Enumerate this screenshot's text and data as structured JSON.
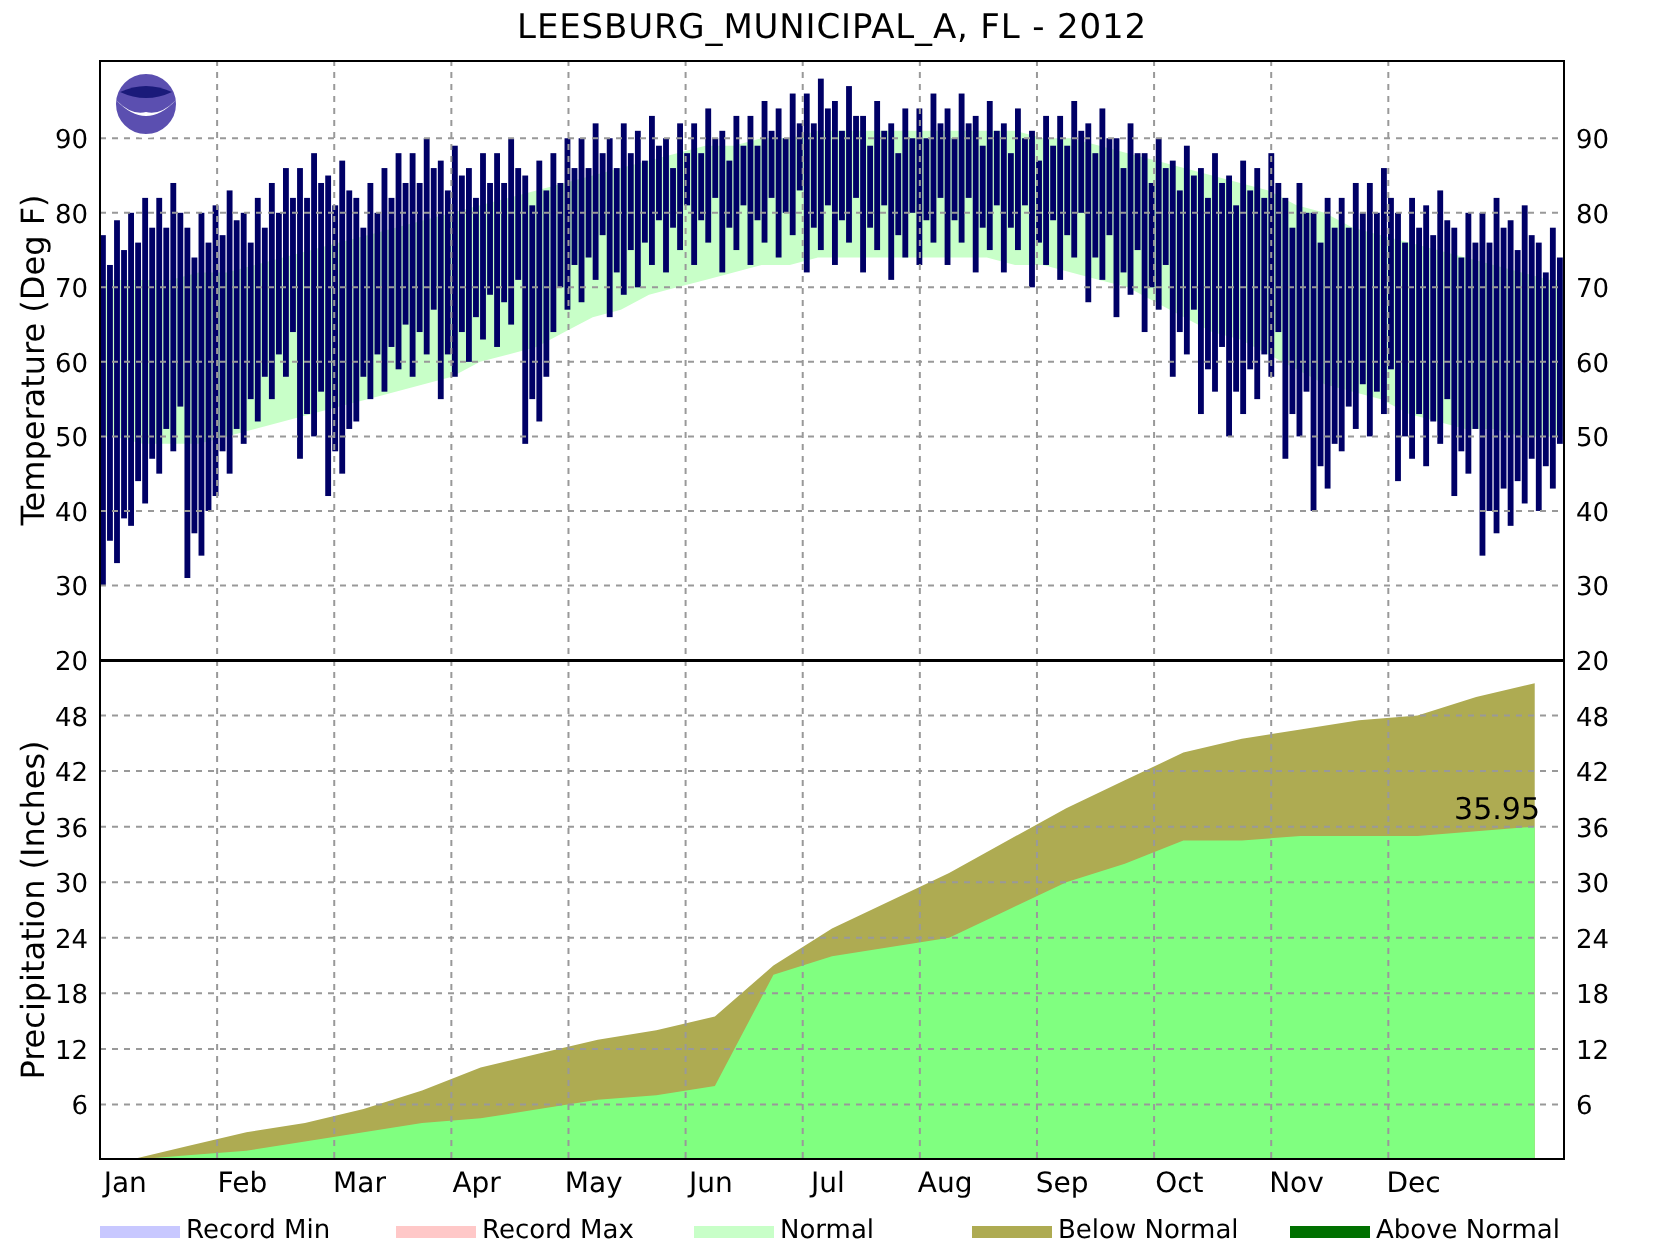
{
  "title": "LEESBURG_MUNICIPAL_A, FL - 2012",
  "temperature": {
    "ylabel": "Temperature (Deg F)",
    "left_yticks": [
      "90",
      "80",
      "70",
      "60",
      "50",
      "40",
      "30",
      "20"
    ],
    "right_yticks": [
      "90",
      "80",
      "70",
      "60",
      "50",
      "40",
      "30",
      "20"
    ]
  },
  "precipitation": {
    "right_yticks": [
      "48",
      "42",
      "36",
      "30",
      "24",
      "18",
      "12",
      "6"
    ],
    "chart_data": {
      "type": "area",
      "ylabel": "Precipitation (Inches)",
      "ylim": [
        0,
        54
      ],
      "yticks": [
        {
          "value": 48,
          "label": "48"
        },
        {
          "value": 42,
          "label": "42"
        },
        {
          "value": 36,
          "label": "36"
        },
        {
          "value": 30,
          "label": "30"
        },
        {
          "value": 24,
          "label": "24"
        },
        {
          "value": 18,
          "label": "18"
        },
        {
          "value": 12,
          "label": "12"
        },
        {
          "value": 6,
          "label": "6"
        }
      ],
      "grid": true,
      "categories": [
        "Jan",
        null,
        "Feb",
        null,
        "Mar",
        null,
        "Apr",
        null,
        "May",
        null,
        "Jun",
        null,
        "Jul",
        null,
        "Aug",
        null,
        "Sep",
        null,
        "Oct",
        null,
        "Nov",
        null,
        "Dec",
        null,
        null
      ],
      "series": [
        {
          "color": "#aeab52",
          "values": [
            0,
            1.5,
            3,
            4,
            5.5,
            7.5,
            10,
            11.5,
            13,
            14,
            15.5,
            21,
            25,
            28,
            31,
            34.5,
            38,
            41,
            44,
            45.5,
            46.5,
            47.5,
            48,
            50,
            51.5
          ]
        },
        {
          "color": "#80ff80",
          "values": [
            0,
            0.5,
            1,
            2,
            3,
            4,
            4.5,
            5.5,
            6.5,
            7,
            8,
            20,
            22,
            23,
            24,
            27,
            30,
            32,
            34.5,
            34.5,
            35,
            35,
            35,
            35.5,
            36
          ]
        }
      ],
      "annotations": [
        "35.95"
      ]
    }
  },
  "legend": [
    {
      "label": "Record Min",
      "color": "#c8c8ff"
    },
    {
      "label": "Record Max",
      "color": "#ffc8c8"
    },
    {
      "label": "Normal",
      "color": "#c8ffc8"
    },
    {
      "label": "Below Normal",
      "color": "#aeab52"
    },
    {
      "label": "Above Normal",
      "color": "#007000"
    }
  ]
}
